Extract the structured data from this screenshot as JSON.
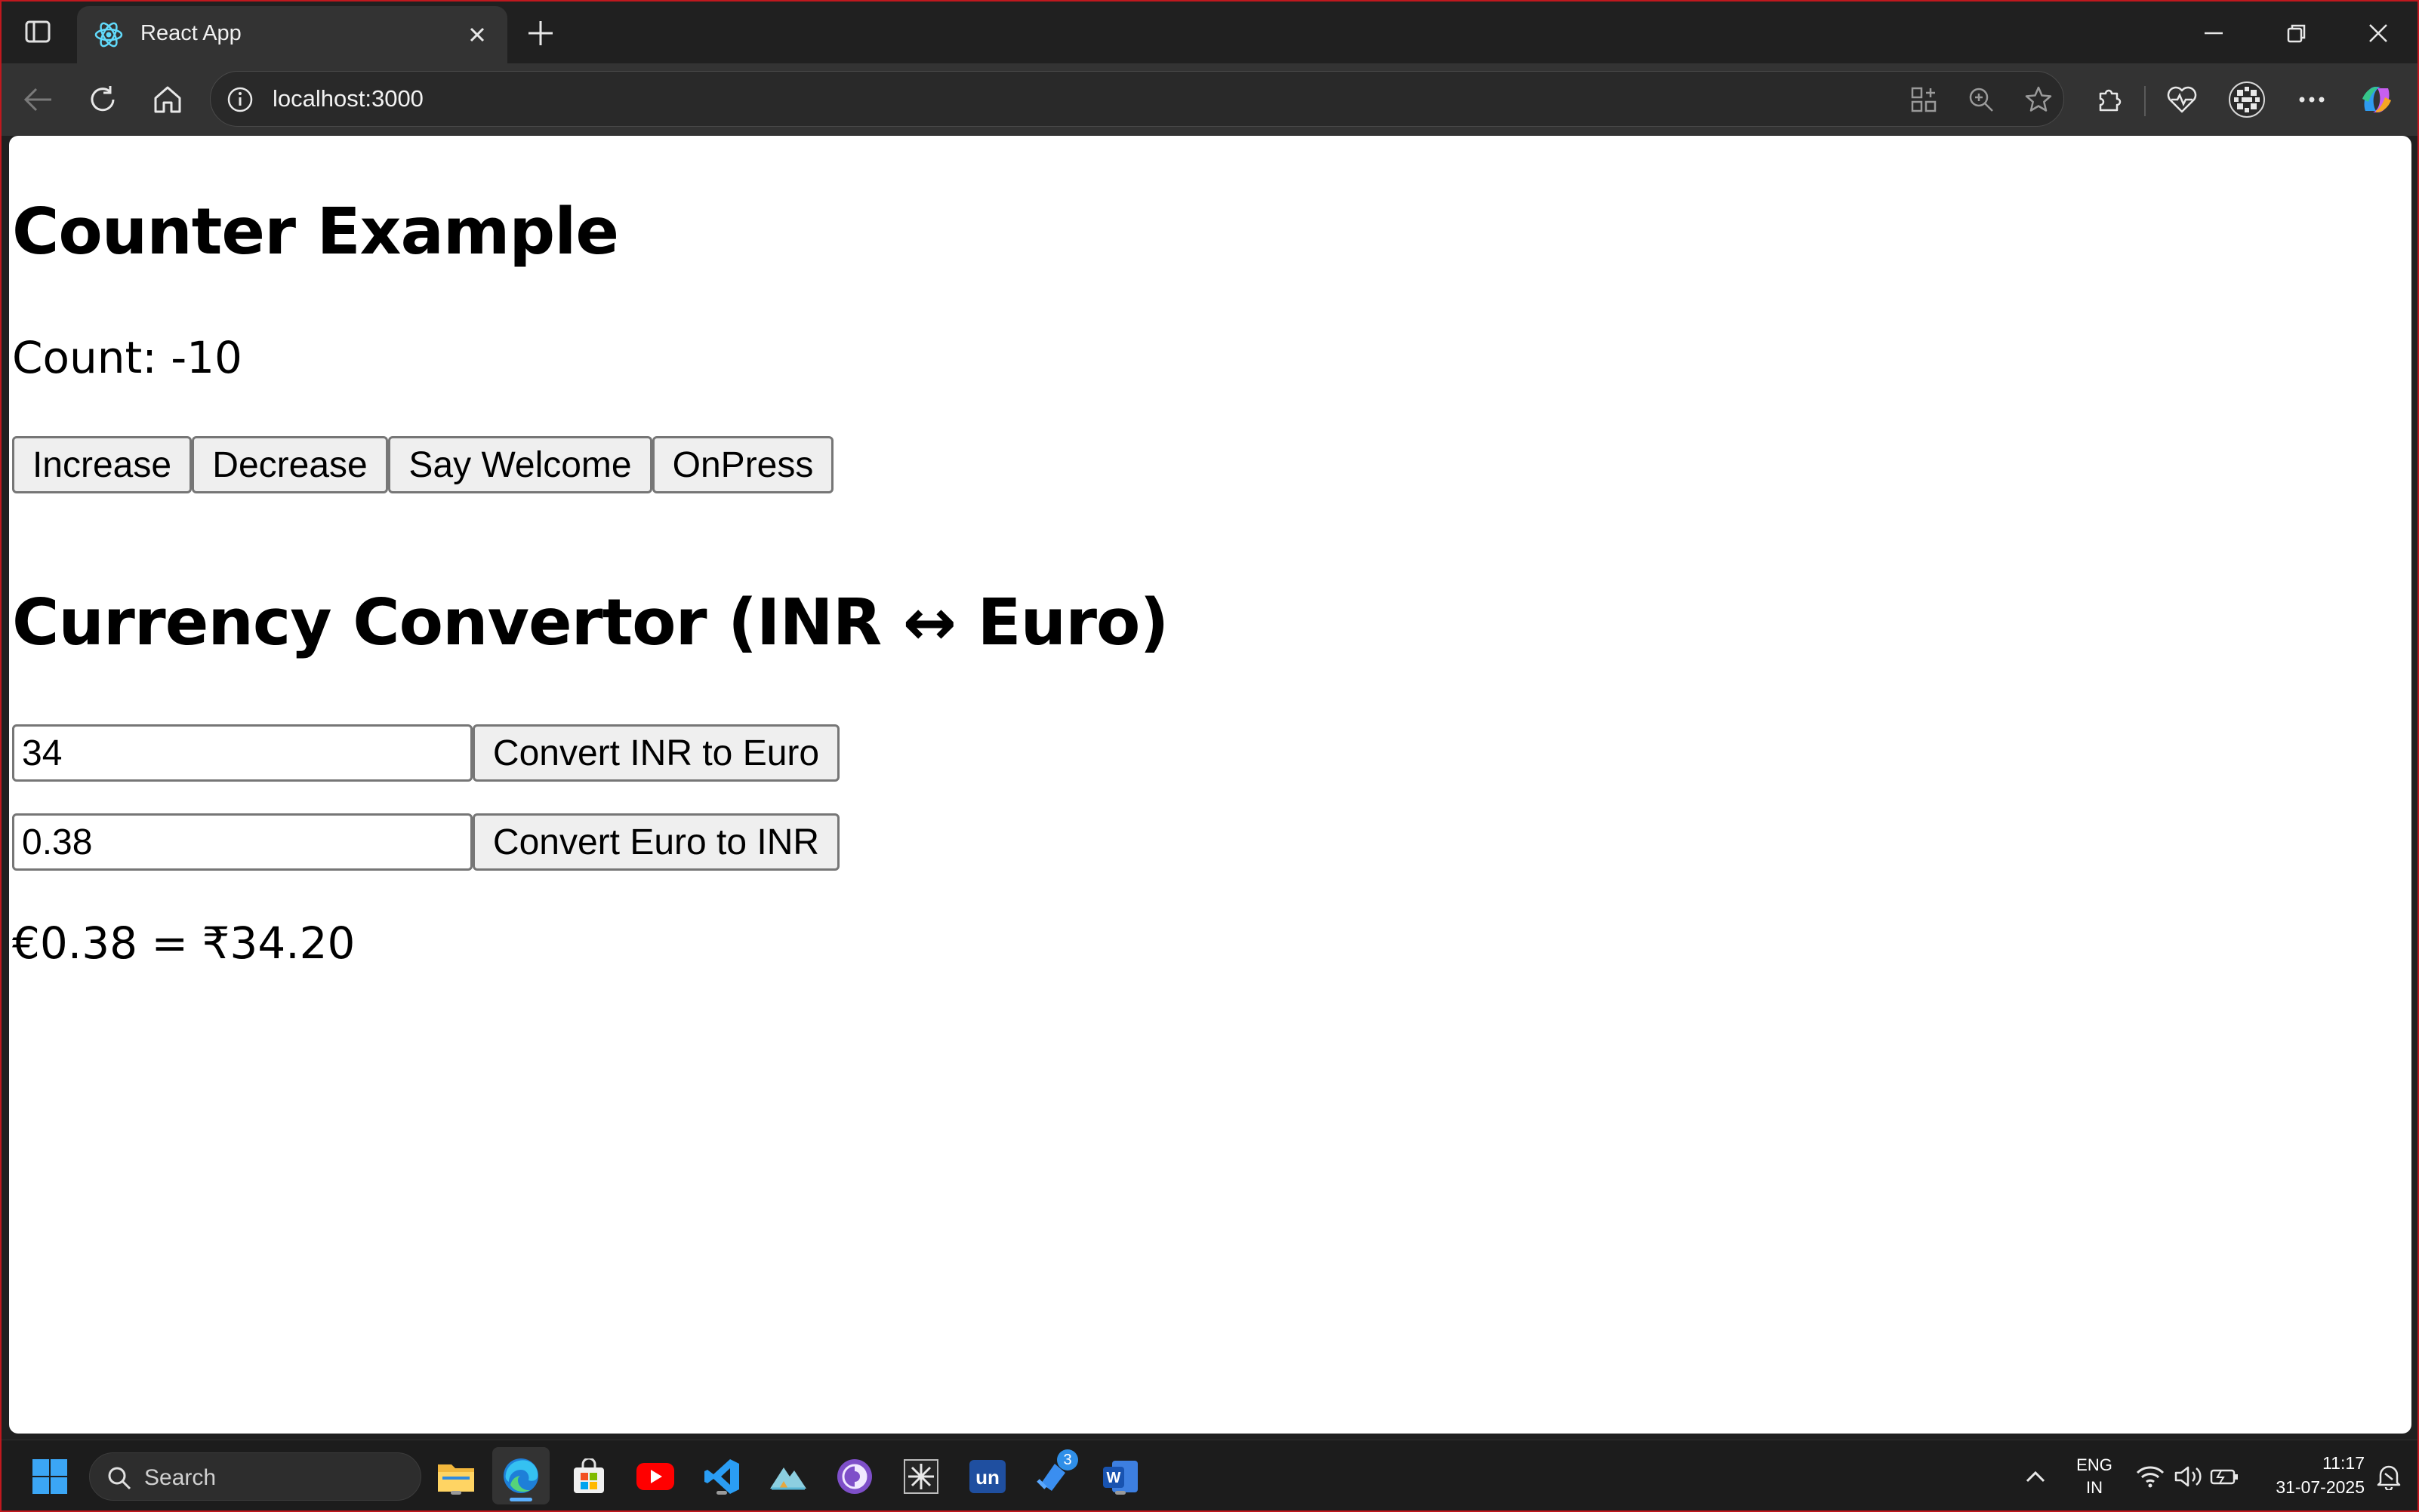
{
  "browser": {
    "tab_title": "React App",
    "url": "localhost:3000"
  },
  "page": {
    "counter_heading": "Counter Example",
    "count_text": "Count: -10",
    "buttons": [
      "Increase",
      "Decrease",
      "Say Welcome",
      "OnPress"
    ],
    "currency_heading": "Currency Convertor (INR ↔ Euro)",
    "inr_input_value": "34",
    "inr_button": "Convert INR to Euro",
    "euro_input_value": "0.38",
    "euro_button": "Convert Euro to INR",
    "result_text": "€0.38 = ₹34.20"
  },
  "taskbar": {
    "search_placeholder": "Search",
    "lang_top": "ENG",
    "lang_bottom": "IN",
    "time": "11:17",
    "date": "31-07-2025",
    "teams_badge": "3"
  },
  "colors": {
    "accent_blue": "#0078d4",
    "window_border": "#c0181e"
  }
}
